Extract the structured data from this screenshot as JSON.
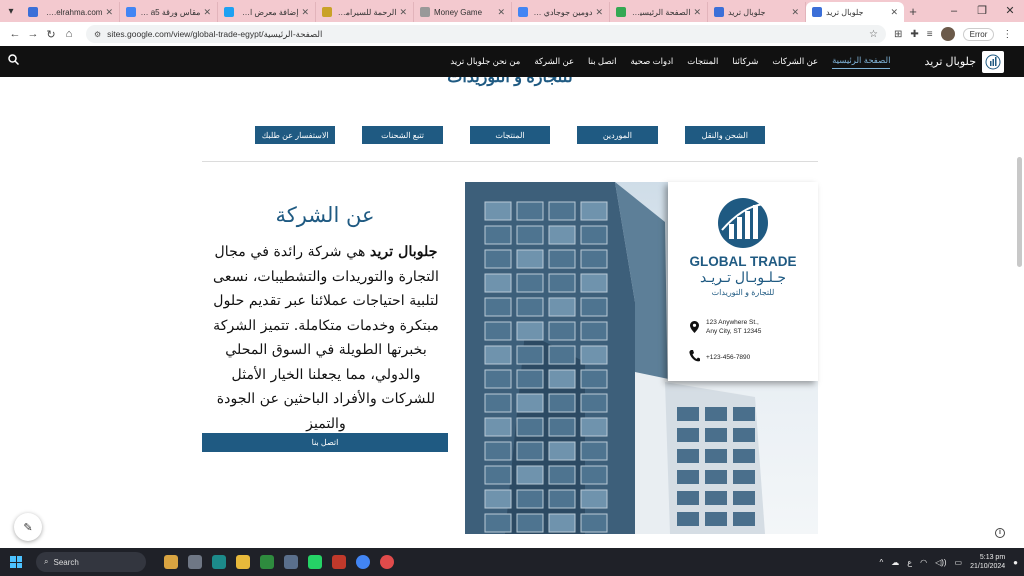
{
  "browser": {
    "tabs": [
      {
        "title": "www.elrahma.com -",
        "color": "#3b6fd8",
        "active": false
      },
      {
        "title": "مقاس ورقة a5 - بحث",
        "color": "#4285f4",
        "active": false
      },
      {
        "title": "إضافة معرض الأعمال",
        "color": "#1da1f2",
        "active": false
      },
      {
        "title": "الرحمة للسيراميك و الأ",
        "color": "#c9a227",
        "active": false
      },
      {
        "title": "Money Game",
        "color": "#999999",
        "active": false
      },
      {
        "title": "دومين جوجادي - بحث",
        "color": "#4285f4",
        "active": false
      },
      {
        "title": "الصفحة الرئيسية - ج",
        "color": "#34a853",
        "active": false
      },
      {
        "title": "جلوبال تريد",
        "color": "#3b6fd8",
        "active": false
      },
      {
        "title": "جلوبال تريد",
        "color": "#3b6fd8",
        "active": true
      }
    ],
    "url": "sites.google.com/view/global-trade-egypt/الصفحة-الرئيسية",
    "error_label": "Error"
  },
  "site": {
    "title": "جلوبال تريد",
    "nav": [
      {
        "label": "الصفحة الرئيسية",
        "active": true
      },
      {
        "label": "عن الشركات",
        "active": false
      },
      {
        "label": "شركائنا",
        "active": false
      },
      {
        "label": "المنتجات",
        "active": false
      },
      {
        "label": "ادوات صحية",
        "active": false
      },
      {
        "label": "اتصل بنا",
        "active": false
      },
      {
        "label": "عن الشركة",
        "active": false
      },
      {
        "label": "من نحن جلوبال تريد",
        "active": false
      }
    ]
  },
  "page": {
    "heading_partial": "للتجارة و التوريدات",
    "buttons": [
      "الشحن والنقل",
      "الموردين",
      "المنتجات",
      "تتبع الشحنات",
      "الاستفسار عن طلبك"
    ],
    "about_title": "عن الشركة",
    "about_lead": "جلوبال تريد",
    "about_body": " هي شركة رائدة في مجال التجارة والتوريدات والتشطيبات، نسعى لتلبية احتياجات عملائنا عبر تقديم حلول مبتكرة وخدمات متكاملة. تتميز الشركة بخبرتها الطويلة في السوق المحلي والدولي، مما يجعلنا الخيار الأمثل للشركات والأفراد الباحثين عن الجودة والتميز",
    "contact_button": "اتصل بنا"
  },
  "card": {
    "brand": "GLOBAL TRADE",
    "brand_ar": "جـلـوبـال تـريـد",
    "tagline_ar": "للتجارة و التوريدات",
    "address_line1": "123 Anywhere St.,",
    "address_line2": "Any City, ST 12345",
    "phone": "+123-456-7890"
  },
  "taskbar": {
    "search_label": "Search",
    "lang": "ع",
    "time": "5:13 pm",
    "date": "21/10/2024"
  },
  "colors": {
    "brand_blue": "#1f5a82",
    "nav_bg": "#111111",
    "tab_strip": "#f3c9cf"
  }
}
